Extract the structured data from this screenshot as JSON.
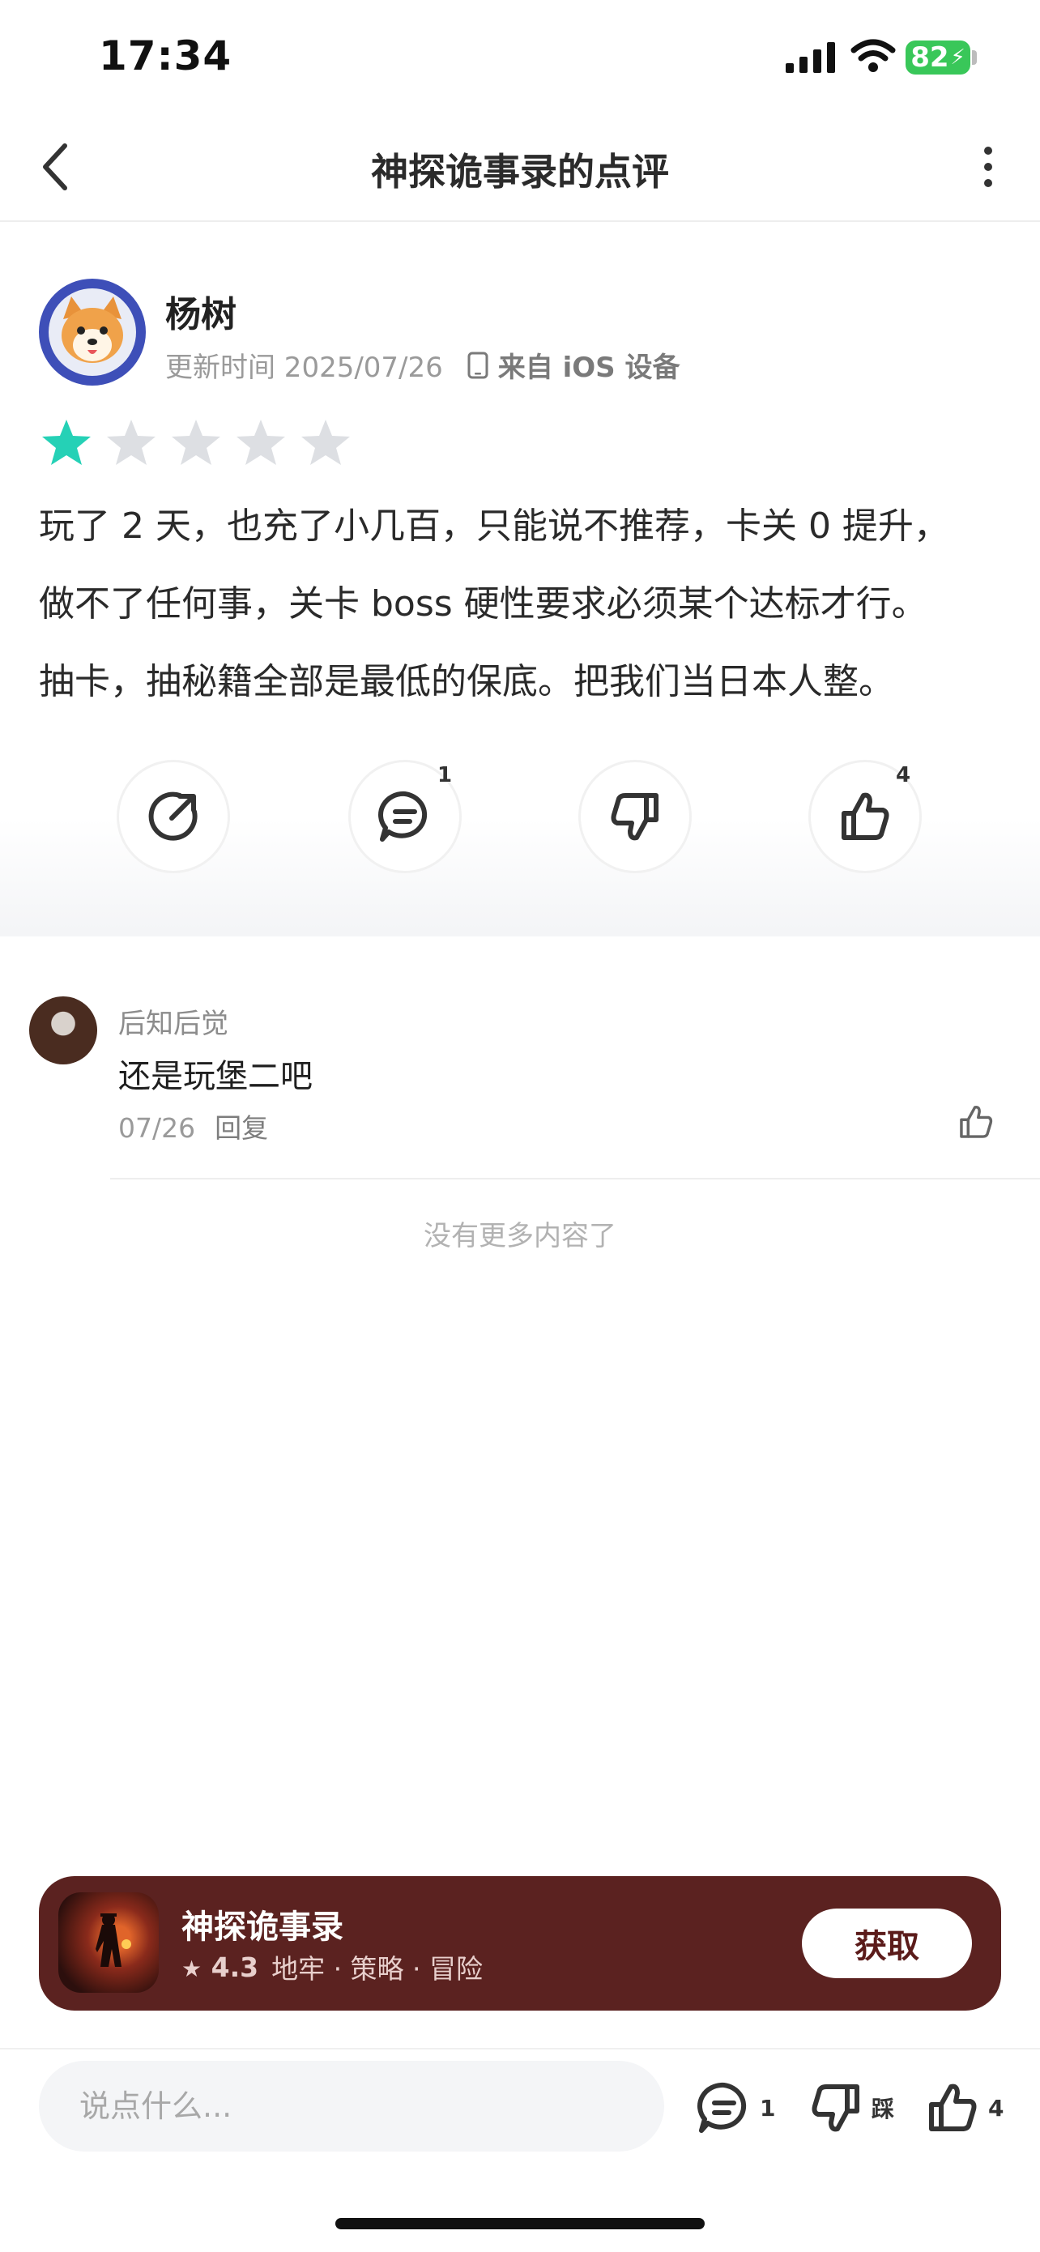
{
  "status_bar": {
    "time": "17:34",
    "battery": "82"
  },
  "nav": {
    "title": "神探诡事录的点评"
  },
  "review": {
    "user": "杨树",
    "updated_label": "更新时间 2025/07/26",
    "device": "来自 iOS 设备",
    "rating": 1,
    "rating_max": 5,
    "text_lines": [
      "玩了 2 天，也充了小几百，只能说不推荐，卡关 0 提升，",
      "做不了任何事，关卡 boss 硬性要求必须某个达标才行。",
      "抽卡，抽秘籍全部是最低的保底。把我们当日本人整。"
    ]
  },
  "actions": {
    "comment_count": "1",
    "like_count": "4"
  },
  "comment": {
    "user": "后知后觉",
    "text": "还是玩堡二吧",
    "date": "07/26",
    "reply_label": "回复"
  },
  "no_more": "没有更多内容了",
  "game": {
    "name": "神探诡事录",
    "rating": "4.3",
    "tags": "地牢 · 策略 · 冒险",
    "get_label": "获取"
  },
  "bottom": {
    "placeholder": "说点什么...",
    "comment_count": "1",
    "dislike_label": "踩",
    "like_count": "4"
  },
  "colors": {
    "accent_star": "#25d1b6",
    "card_bg": "#5b2220",
    "battery": "#39c759"
  }
}
